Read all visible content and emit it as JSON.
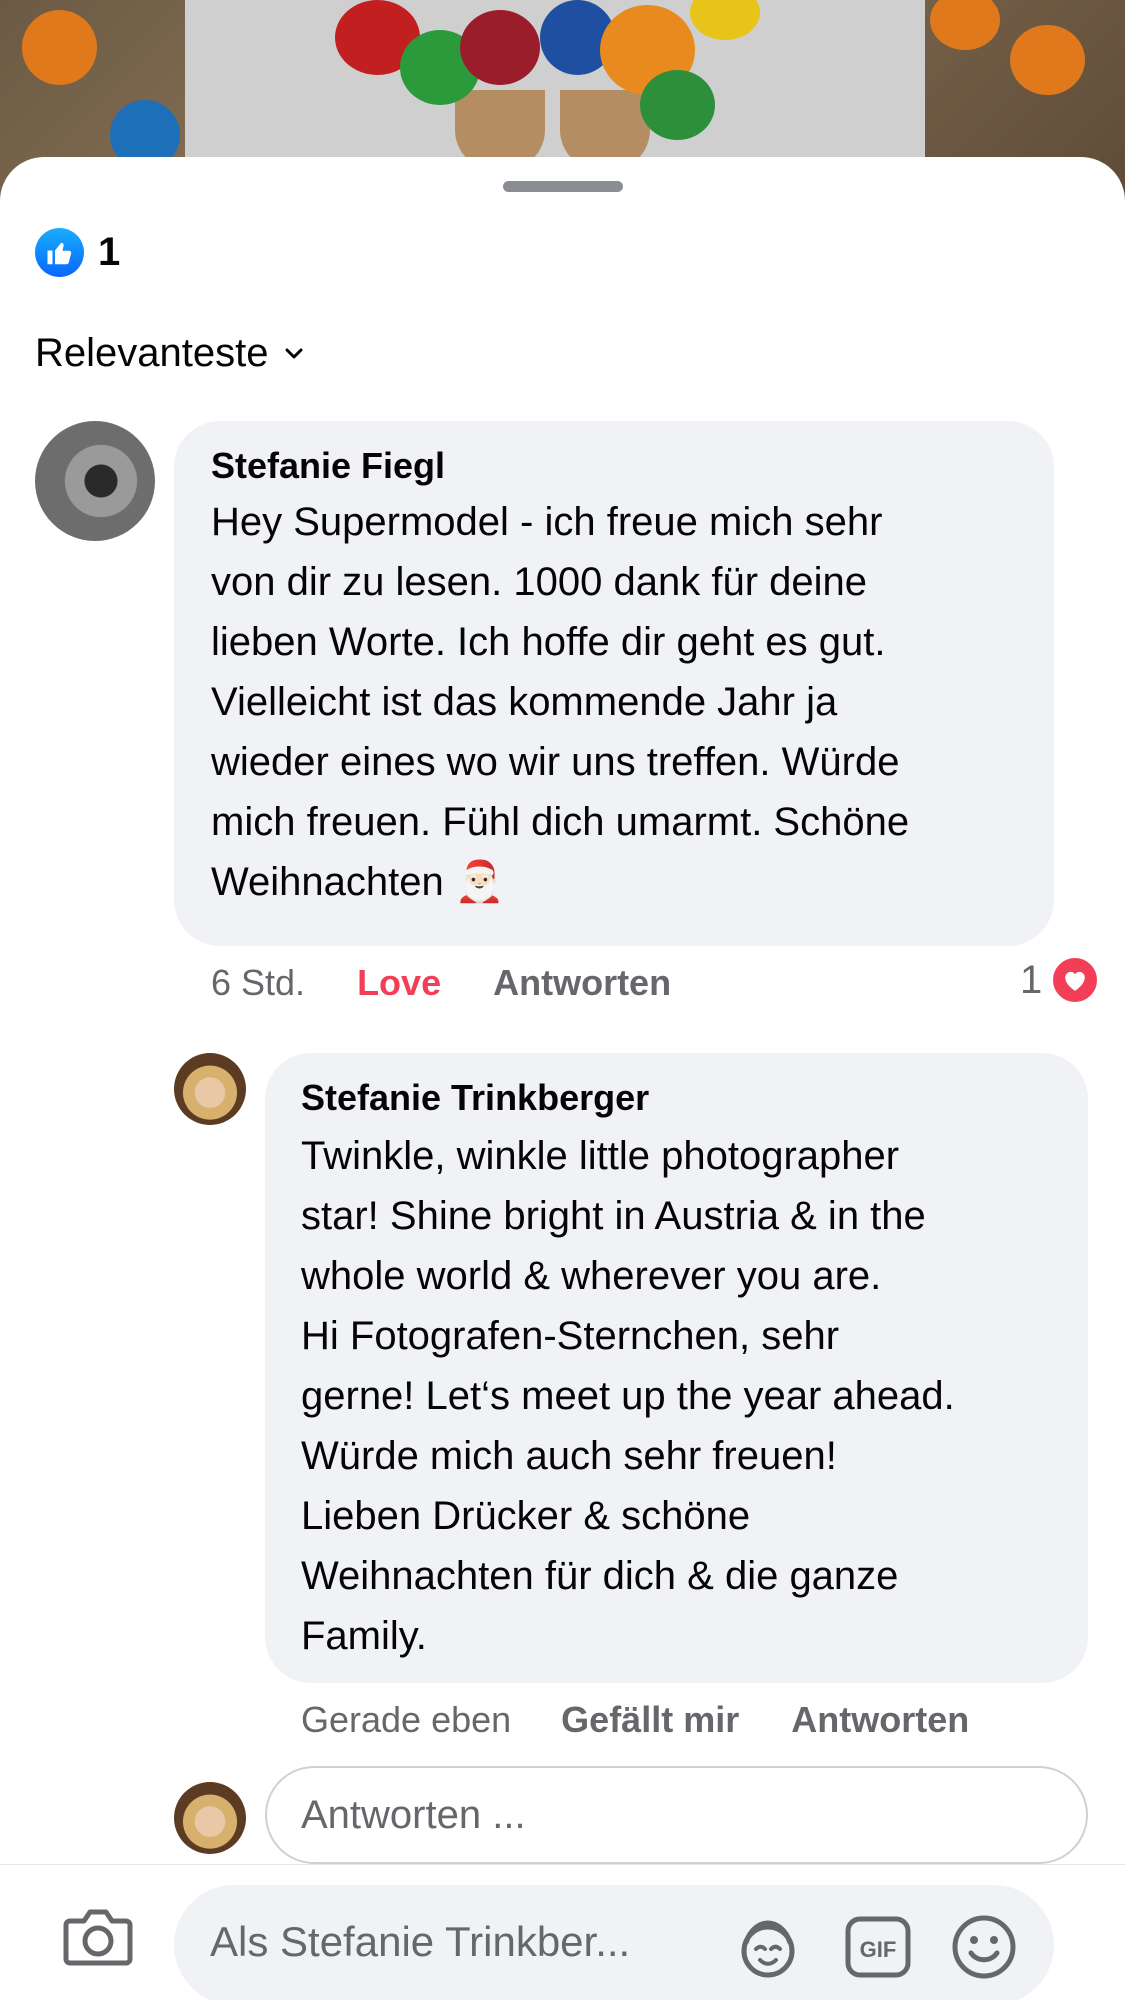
{
  "reactions": {
    "like_count": "1"
  },
  "sort": {
    "label": "Relevanteste"
  },
  "comment": {
    "author": "Stefanie Fiegl",
    "text": "Hey Supermodel - ich freue mich sehr\nvon dir zu lesen. 1000 dank für deine\nlieben Worte. Ich hoffe dir geht es gut.\nVielleicht ist das kommende Jahr ja\nwieder eines wo wir uns treffen. Würde\nmich freuen. Fühl dich umarmt. Schöne\nWeihnachten 🎅🏻",
    "time": "6 Std.",
    "reaction_label": "Love",
    "reply_label": "Antworten",
    "love_count": "1"
  },
  "reply": {
    "author": "Stefanie Trinkberger",
    "text": "Twinkle, winkle little photographer\nstar! Shine bright in Austria & in the\nwhole world & wherever you are.\nHi Fotografen-Sternchen, sehr\ngerne! Let‘s meet up the year ahead.\nWürde mich auch sehr freuen!\nLieben Drücker & schöne\nWeihnachten für dich & die ganze\nFamily.",
    "time": "Gerade eben",
    "like_label": "Gefällt mir",
    "reply_label": "Antworten"
  },
  "reply_input": {
    "placeholder": "Antworten ..."
  },
  "composer": {
    "placeholder": "Als Stefanie Trinkber..."
  },
  "colors": {
    "like_blue": "#0866ff",
    "love_red": "#f33e58",
    "bubble": "#f0f2f5",
    "secondary_text": "#65676b"
  },
  "icons": [
    "like-icon",
    "chevron-down-icon",
    "heart-icon",
    "camera-icon",
    "avatar-sticker-icon",
    "gif-icon",
    "emoji-icon"
  ]
}
